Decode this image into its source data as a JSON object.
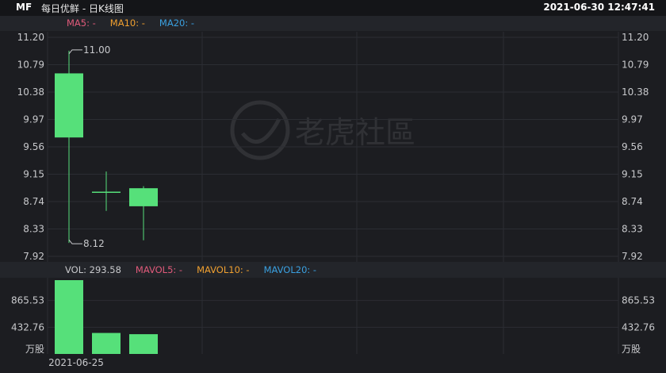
{
  "header": {
    "symbol": "MF",
    "name": "每日优鲜 - 日K线图",
    "timestamp": "2021-06-30 12:47:41"
  },
  "legend": {
    "ma5": "MA5: -",
    "ma10": "MA10: -",
    "ma20": "MA20: -",
    "vol": "VOL: 293.58",
    "mavol5": "MAVOL5: -",
    "mavol10": "MAVOL10: -",
    "mavol20": "MAVOL20: -"
  },
  "colors": {
    "up": "#56e07a",
    "ma5": "#e05a7a",
    "ma10": "#f0a030",
    "ma20": "#3aa0e0",
    "vol_label": "#c8c9cc"
  },
  "watermark": "老虎社區",
  "chart_data": [
    {
      "type": "candlestick",
      "y_ticks": [
        "11.20",
        "10.79",
        "10.38",
        "9.97",
        "9.56",
        "9.15",
        "8.74",
        "8.33",
        "7.92"
      ],
      "ylim": [
        7.92,
        11.2
      ],
      "candles": [
        {
          "open": 9.7,
          "close": 10.66,
          "high": 11.0,
          "low": 8.12
        },
        {
          "open": 8.88,
          "close": 8.88,
          "high": 9.19,
          "low": 8.6
        },
        {
          "open": 8.67,
          "close": 8.94,
          "high": 8.97,
          "low": 8.16
        }
      ],
      "annotations": {
        "high": "11.00",
        "low": "8.12"
      }
    },
    {
      "type": "bar",
      "y_ticks": [
        "865.53",
        "432.76"
      ],
      "unit": "万股",
      "ylim": [
        0,
        1195
      ],
      "values": [
        1195,
        340,
        320
      ],
      "x_label": "2021-06-25"
    }
  ]
}
